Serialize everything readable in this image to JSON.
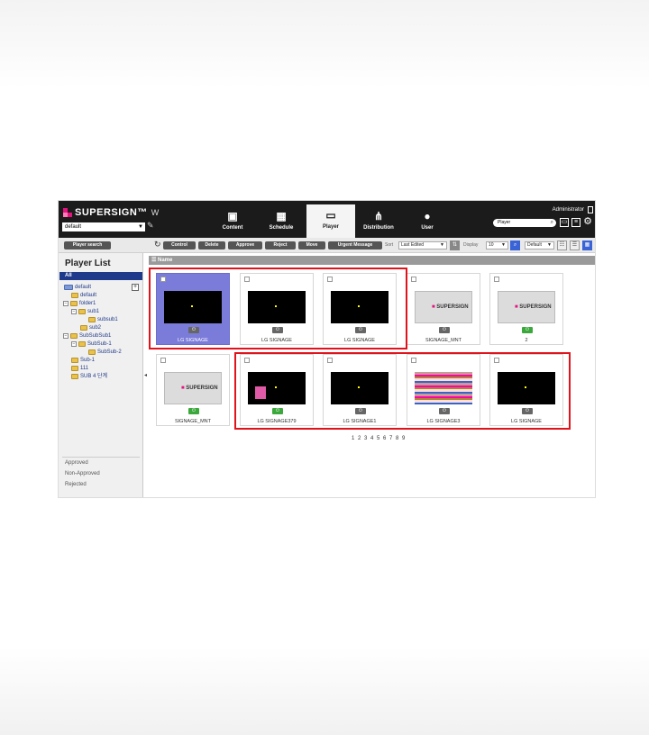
{
  "app": {
    "logo_text": "SUPERSIGN™",
    "logo_suffix": "W",
    "site_selected": "default",
    "user": "Administrator",
    "search_placeholder": "Player"
  },
  "nav": {
    "tabs": [
      {
        "label": "Content",
        "icon": "content-icon"
      },
      {
        "label": "Schedule",
        "icon": "calendar-icon"
      },
      {
        "label": "Player",
        "icon": "monitor-icon"
      },
      {
        "label": "Distribution",
        "icon": "network-icon"
      },
      {
        "label": "User",
        "icon": "user-icon"
      }
    ],
    "active": "Player"
  },
  "toolbar": {
    "player_search": "Player search",
    "control": "Control",
    "delete": "Delete",
    "approve": "Approve",
    "reject": "Reject",
    "move": "Move",
    "urgent": "Urgent Message",
    "sort_label": "Sort",
    "sort_value": "Last Edited",
    "display_label": "Display",
    "display_value": "10",
    "view_value": "Default"
  },
  "sidebar": {
    "title": "Player List",
    "all": "All",
    "tree": [
      "default",
      "default",
      "folder1",
      "sub1",
      "subsub1",
      "sub2",
      "SubSubSub1",
      "SubSub-1",
      "SubSub-2",
      "Sub-1",
      "111",
      "SUB 4 단계"
    ],
    "statuses": [
      "Approved",
      "Non-Approved",
      "Rejected"
    ]
  },
  "list": {
    "column": "Name",
    "players": [
      {
        "name": "LG SIGNAGE",
        "thumb": "black",
        "power": "off",
        "selected": true
      },
      {
        "name": "LG SIGNAGE",
        "thumb": "black",
        "power": "off",
        "selected": false
      },
      {
        "name": "LG SIGNAGE",
        "thumb": "black",
        "power": "off",
        "selected": false
      },
      {
        "name": "SIGNAGE_MNT",
        "thumb": "supersign",
        "power": "off",
        "selected": false
      },
      {
        "name": "2",
        "thumb": "supersign",
        "power": "on",
        "selected": false
      },
      {
        "name": "SIGNAGE_MNT",
        "thumb": "supersign",
        "power": "on",
        "selected": false
      },
      {
        "name": "LG SIGNAGE379",
        "thumb": "black-pink",
        "power": "on",
        "selected": false
      },
      {
        "name": "LG SIGNAGE1",
        "thumb": "black",
        "power": "off",
        "selected": false
      },
      {
        "name": "LG SIGNAGE3",
        "thumb": "photo",
        "power": "off",
        "selected": false
      },
      {
        "name": "LG SIGNAGE",
        "thumb": "black",
        "power": "off",
        "selected": false
      }
    ],
    "pagination": "1 2 3 4 5 6 7 8 9"
  },
  "colors": {
    "topbar": "#1b1b1b",
    "brand_pink": "#e5137e",
    "selected_card": "#7b7bda",
    "highlight_red": "#e0121b",
    "all_item": "#1f3a8a"
  }
}
